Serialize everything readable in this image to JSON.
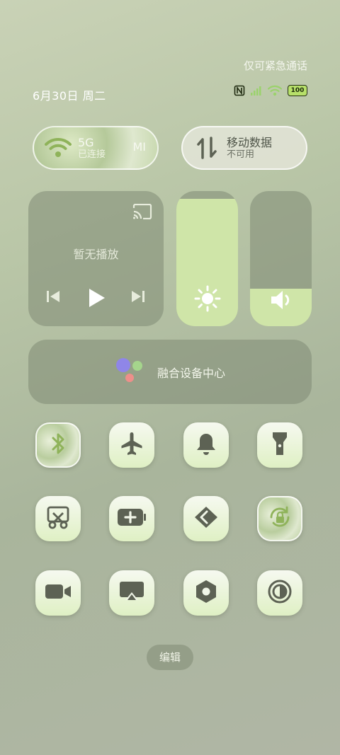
{
  "status": {
    "emergency": "仅可紧急通话",
    "date": "6月30日 周二",
    "battery": "100",
    "icons": [
      "nfc-icon",
      "signal-icon",
      "wifi-icon",
      "battery-icon"
    ]
  },
  "wifi": {
    "network": "5G",
    "brand": "MI",
    "status": "已连接"
  },
  "mobile_data": {
    "title": "移动数据",
    "status": "不可用"
  },
  "media": {
    "label": "暂无播放"
  },
  "sliders": {
    "brightness_level": 0.94,
    "volume_level": 0.28
  },
  "device_center": {
    "label": "融合设备中心"
  },
  "toggles": [
    "bluetooth-icon",
    "airplane-mode-icon",
    "bell-icon",
    "flashlight-icon",
    "screenshot-icon",
    "battery-saver-icon",
    "mi-share-icon",
    "rotation-lock-icon",
    "screen-recorder-icon",
    "cast-icon",
    "settings-icon",
    "dark-mode-icon"
  ],
  "edit_label": "编辑",
  "colors": {
    "accent": "#cfe5a8",
    "icon": "#5d6254",
    "active_icon": "#8fb35a"
  }
}
